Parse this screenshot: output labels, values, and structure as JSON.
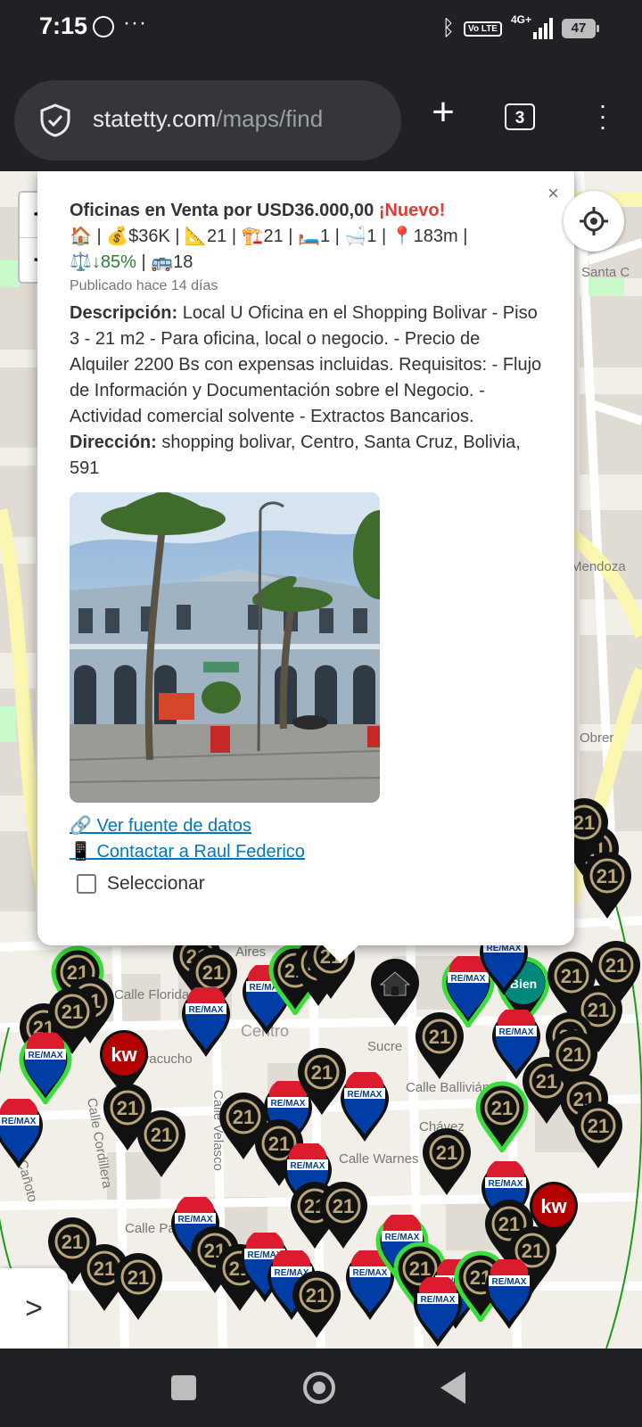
{
  "status": {
    "time": "7:15",
    "dots": "···",
    "network": "4G+",
    "volte": "Vo LTE",
    "battery": "47"
  },
  "browser": {
    "url_domain": "statetty.com",
    "url_path": "/maps/find",
    "tab_count": "3"
  },
  "map": {
    "zoom_in": "+",
    "zoom_out": "−",
    "sidebar_toggle": ">"
  },
  "popup": {
    "close": "×",
    "title": "Oficinas en Venta por USD36.000,00",
    "new_badge": "¡Nuevo!",
    "stats_line1": "🏠 | 💰$36K | 📐21 | 🏗️21 | 🛏️1 | 🛁1 | 📍183m |",
    "stats_ratio": "⚖️↓85%",
    "stats_transit": " | 🚌18",
    "published": "Publicado hace 14 días",
    "description_label": "Descripción:",
    "description": " Local U Oficina en el Shopping Bolivar - Piso 3 - 21 m2 - Para oficina, local o negocio. - Precio de Alquiler 2200 Bs con expensas incluidas. Requisitos: - Flujo de Información y Documentación sobre el Negocio. - Actividad comercial solvente - Extractos Bancarios.",
    "address_label": "Dirección:",
    "address": " shopping bolivar, Centro, Santa Cruz, Bolivia, 591",
    "source_link": "🔗 Ver fuente de datos",
    "contact_link": "📱 Contactar a Raul Federico",
    "select_label": "Seleccionar"
  },
  "street_labels": {
    "santa_cruz": "Santa C",
    "mendoza": "Mendoza",
    "obrer": "Obrer",
    "florida": "Calle Florida",
    "sucre": "Sucre",
    "ballivian": "Calle Ballivián",
    "chavez": "Chávez",
    "warnes": "Calle Warnes",
    "velasco": "Calle Velasco",
    "cordillera": "Calle Cordillera",
    "canoto": "Cañoto",
    "pari": "Calle Pari",
    "aires": "Aires",
    "ayacucho": "Ayacucho",
    "centro": "Centro"
  },
  "brands": {
    "c21": "21",
    "remax": "RE/MAX",
    "kw": "kw",
    "bien": "Bien"
  },
  "colors": {
    "c21_gold": "#b9a57a",
    "remax_red": "#dc1c2e",
    "remax_blue": "#003da5",
    "kw_red": "#b40101",
    "bien_teal": "#00897b",
    "highlight_green": "#3ddc3d"
  }
}
